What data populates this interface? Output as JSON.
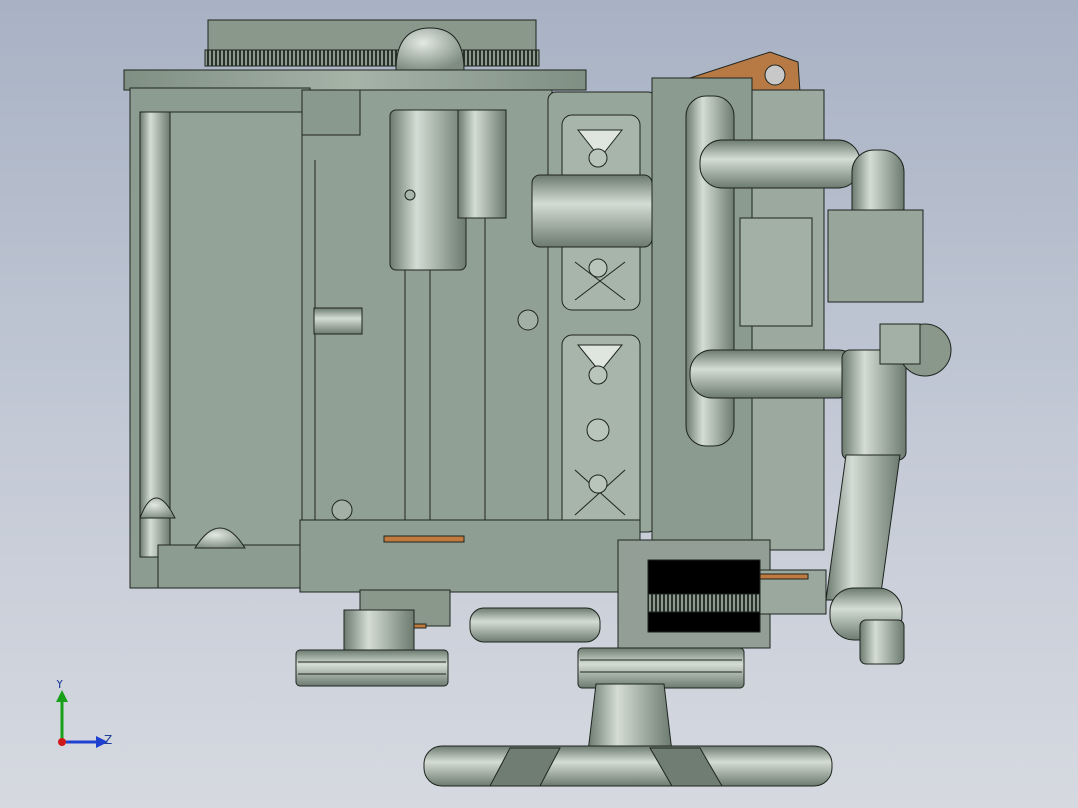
{
  "viewport": {
    "background_top": "#a8b2c4",
    "background_bottom": "#d6d9e0"
  },
  "colors": {
    "metal": "#93a396",
    "metal_dark": "#5f6d62",
    "metal_light": "#c3cec4",
    "edge": "#1e241f",
    "copper": "#c07a3e",
    "bracket": "#b87a45",
    "axis_y": "#18a018",
    "axis_z": "#1f3fd0",
    "axis_x": "#d01818"
  },
  "triad": {
    "y_label": "Y",
    "z_label": "Z",
    "icons": [
      "y-axis-arrow-icon",
      "z-axis-arrow-icon",
      "x-axis-origin-icon"
    ]
  }
}
